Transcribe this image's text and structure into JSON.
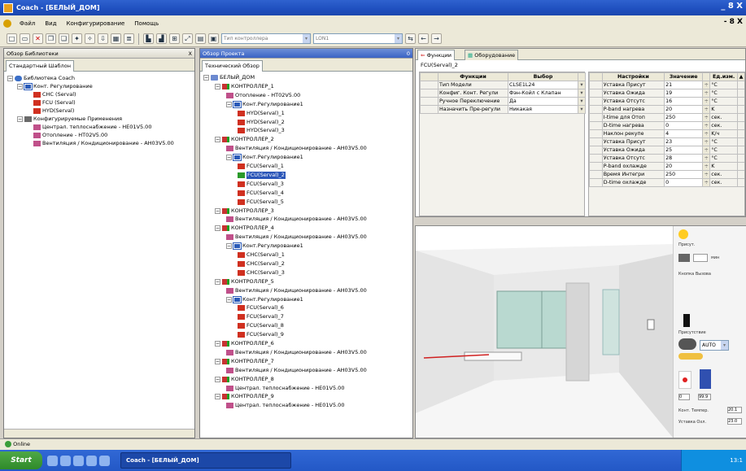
{
  "window": {
    "title": "Coach - [БЕЛЫЙ_ДОМ]"
  },
  "menu": [
    "Файл",
    "Вид",
    "Конфигурирование",
    "Помощь"
  ],
  "toolbar": {
    "combo_type": "Тип контроллера",
    "combo_lon": "LON1"
  },
  "library": {
    "header": "Обзор Библиотеки",
    "close": "X",
    "tab": "Стандартный Шаблон",
    "items": [
      "Библиотека Coach",
      "Конт. Регулирование",
      "CHC (Serval)",
      "FCU (Serval)",
      "HYD(Serval)",
      "Конфигурируемые Применения",
      "Централ. теплоснабжение - HE01V5.00",
      "Отопление - HT02V5.00",
      "Вентиляция / Кондиционирование - AH03V5.00"
    ]
  },
  "project": {
    "header": "Обзор Проекта",
    "tab": "Технический Обзор",
    "items": [
      "БЕЛЫЙ_ДОМ",
      "КОНТРОЛЛЕР_1",
      "Отопление - HT02V5.00",
      "Конт.Регулирование1",
      "HYD(Serval)_1",
      "HYD(Serval)_2",
      "HYD(Serval)_3",
      "КОНТРОЛЛЕР_2",
      "Вентиляция / Кондиционирование - AH03V5.00",
      "Конт.Регулирование1",
      "FCU(Serval)_1",
      "FCU(Serval)_2",
      "FCU(Serval)_3",
      "FCU(Serval)_4",
      "FCU(Serval)_5",
      "КОНТРОЛЛЕР_3",
      "Вентиляция / Кондиционирование - AH03V5.00",
      "КОНТРОЛЛЕР_4",
      "Вентиляция / Кондиционирование - AH03V5.00",
      "Конт.Регулирование1",
      "CHC(Serval)_1",
      "CHC(Serval)_2",
      "CHC(Serval)_3",
      "КОНТРОЛЛЕР_5",
      "Вентиляция / Кондиционирование - AH03V5.00",
      "Конт.Регулирование1",
      "FCU(Serval)_6",
      "FCU(Serval)_7",
      "FCU(Serval)_8",
      "FCU(Serval)_9",
      "КОНТРОЛЛЕР_6",
      "Вентиляция / Кондиционирование - AH03V5.00",
      "КОНТРОЛЛЕР_7",
      "Вентиляция / Кондиционирование - AH03V5.00",
      "КОНТРОЛЛЕР_8",
      "Централ. теплоснабжение - HE01V5.00",
      "КОНТРОЛЛЕР_9",
      "Централ. теплоснабжение - HE01V5.00"
    ]
  },
  "detail": {
    "tab_functions": "Функции",
    "tab_equipment": "Оборудование",
    "object": "FCU(Serval)_2",
    "func_headers": [
      "Функции",
      "Выбор"
    ],
    "func_rows": [
      [
        "Тип Модели",
        "CLSE1L24"
      ],
      [
        "Конфиг. Конт. Регули",
        "Фэн-Койл с Клапан"
      ],
      [
        "Ручное Переключение",
        "Да"
      ],
      [
        "Назначить Пре-регули",
        "Никакая"
      ]
    ],
    "set_headers": [
      "Настройки",
      "Значение",
      "Ед.изм."
    ],
    "set_rows": [
      [
        "Уставка Присут",
        "21",
        "°C"
      ],
      [
        "Уставка Ожида",
        "19",
        "°C"
      ],
      [
        "Уставка Отсутс",
        "16",
        "°C"
      ],
      [
        "P-band нагрева",
        "20",
        "K"
      ],
      [
        "I-time для Отоп",
        "250",
        "сек."
      ],
      [
        "D-time нагрева",
        "0",
        "сек."
      ],
      [
        "Наклон рекупе",
        "4",
        "K/ч"
      ],
      [
        "Уставка Присут",
        "23",
        "°C"
      ],
      [
        "Уставка Ожида",
        "25",
        "°C"
      ],
      [
        "Уставка Отсутс",
        "28",
        "°C"
      ],
      [
        "P-band охлажде",
        "20",
        "K"
      ],
      [
        "Время Интегри",
        "250",
        "сек."
      ],
      [
        "D-time охлажде",
        "0",
        "сек."
      ]
    ]
  },
  "sim": {
    "presence": "Присут.",
    "button_label": "Кнопка Вызова",
    "presence2": "Присутствие",
    "mode": "AUTO",
    "percent1": "0",
    "percent2": "99.9",
    "temp_label": "Конт. Темпер.",
    "temp_val": "20.1",
    "setpoint_label": "Уставка Охл.",
    "setpoint_val": "23.0",
    "min": "мин"
  },
  "status": {
    "text": "Online"
  },
  "taskbar": {
    "start": "Start",
    "item": "Coach - [БЕЛЫЙ_ДОМ]",
    "clock": "13:1"
  }
}
